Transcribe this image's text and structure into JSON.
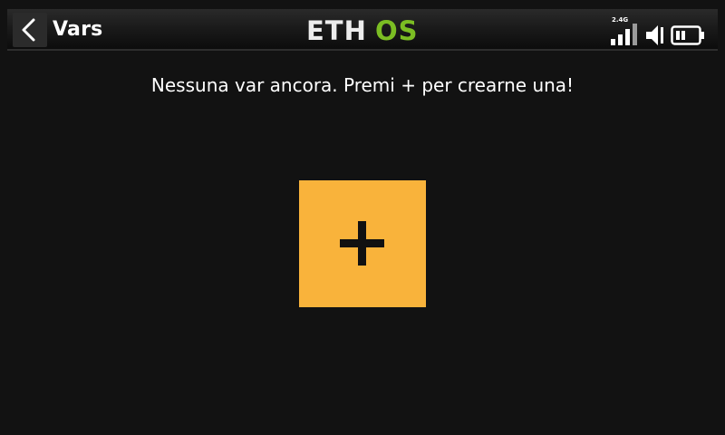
{
  "header": {
    "title": "Vars",
    "logo": {
      "part1": "ETH",
      "part2": "OS",
      "color_part1": "#ededed",
      "color_part2": "#7bbd23"
    },
    "status": {
      "rf_band": "2.4G",
      "icons": [
        "signal-icon",
        "volume-icon",
        "battery-icon"
      ]
    },
    "back_icon": "chevron-left-icon"
  },
  "main": {
    "empty_message": "Nessuna var ancora. Premi + per crearne una!",
    "add_button": {
      "icon": "plus-icon",
      "color": "#f9b33b"
    }
  }
}
